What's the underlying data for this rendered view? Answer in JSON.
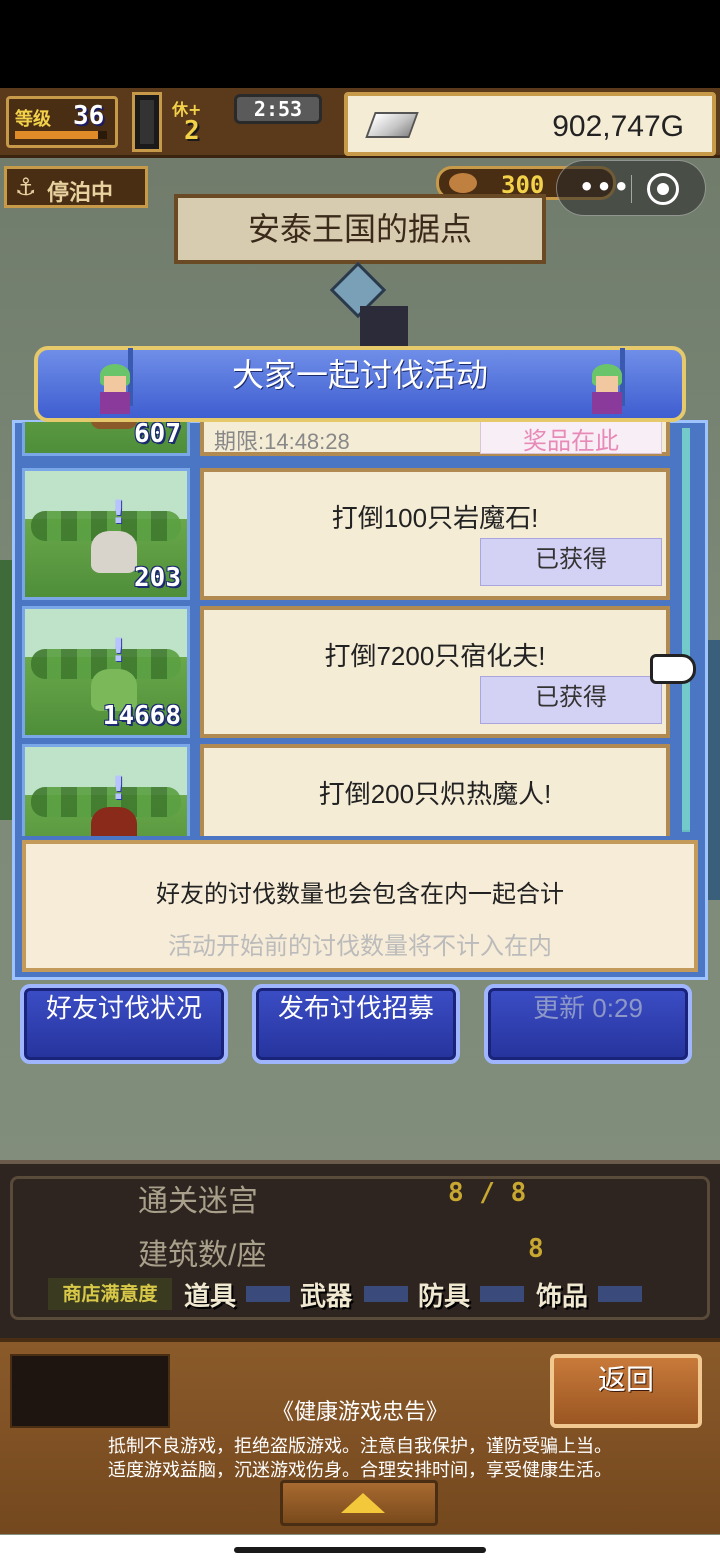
{
  "hud": {
    "level_label": "等级",
    "level_value": "36",
    "level_progress": 0.9,
    "bonus_label": "休+",
    "bonus_value": "2",
    "timer": "2:53",
    "gold": "902,747G",
    "status": "停泊中",
    "population": "300",
    "location": "安泰王国的据点"
  },
  "dialog": {
    "title": "大家一起讨伐活动",
    "missions": [
      {
        "count": "607",
        "title": "",
        "deadline": "期限:14:48:28",
        "status": "奖品在此",
        "monster_color": "#8a5a2a"
      },
      {
        "count": "203",
        "title": "打倒100只岩魔石!",
        "status": "已获得",
        "monster_color": "#d8d4cc"
      },
      {
        "count": "14668",
        "title": "打倒7200只宿化夫!",
        "status": "已获得",
        "monster_color": "#7ab85a"
      },
      {
        "count": "",
        "title": "打倒200只炽热魔人!",
        "status": "",
        "monster_color": "#8a2a1a"
      }
    ],
    "info_line1": "好友的讨伐数量也会包含在内一起合计",
    "info_line2": "活动开始前的讨伐数量将不计入在内",
    "buttons": {
      "friend_status": "好友讨伐状况",
      "post_recruit": "发布讨伐招募",
      "refresh": "更新 0:29"
    }
  },
  "stats": {
    "dungeon_label": "通关迷宫",
    "dungeon_value": "8 / 8",
    "buildings_label": "建筑数/座",
    "buildings_value": "8",
    "satisfaction_label": "商店满意度",
    "categories": [
      "道具",
      "武器",
      "防具",
      "饰品"
    ]
  },
  "footer": {
    "back": "返回",
    "notice_title": "《健康游戏忠告》",
    "notice_line1": "抵制不良游戏，拒绝盗版游戏。注意自我保护，谨防受骗上当。",
    "notice_line2": "适度游戏益脑，沉迷游戏伤身。合理安排时间，享受健康生活。"
  },
  "miniprogram": {
    "more": "•••"
  }
}
